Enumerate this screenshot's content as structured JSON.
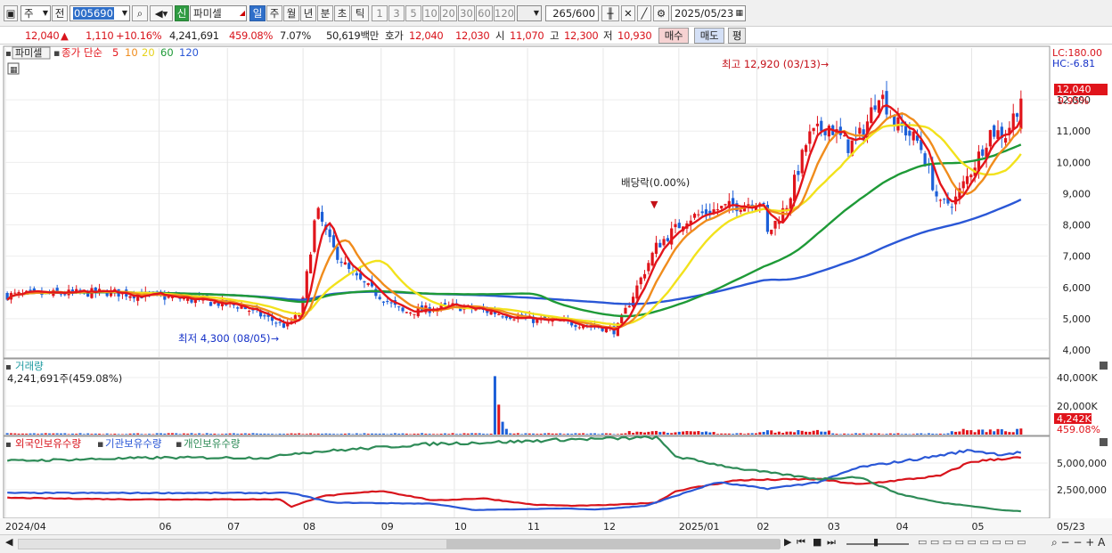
{
  "toolbar": {
    "market": "주",
    "ref_label": "전",
    "code": "005690",
    "badge": "신",
    "name": "파미셀",
    "periods": [
      "일",
      "주",
      "월",
      "년",
      "분",
      "초",
      "틱"
    ],
    "active_period": "일",
    "intervals": [
      "1",
      "3",
      "5",
      "10",
      "20",
      "30",
      "60",
      "120"
    ],
    "count": "265",
    "count_max": "/600",
    "date": "2025/05/23"
  },
  "quote": {
    "price": "12,040",
    "arrow": "▲",
    "change": "1,110",
    "change_pct": "+10.16%",
    "volume": "4,241,691",
    "volume_ratio": "459.08%",
    "turnover": "7.07%",
    "value": "50,619백만",
    "ask_label": "호가",
    "ask": "12,040",
    "bid": "12,030",
    "open_label": "시",
    "open": "11,070",
    "high_label": "고",
    "high": "12,300",
    "low_label": "저",
    "low": "10,930",
    "buy_btn": "매수",
    "sell_btn": "매도",
    "eval_btn": "평"
  },
  "price_panel": {
    "stock_tag": "파미셀",
    "legend_close": "종가 단순",
    "ma_labels": [
      "5",
      "10",
      "20",
      "60",
      "120"
    ],
    "lc": "LC:180.00",
    "hc": "HC:-6.81",
    "last_price": "12,040",
    "last_pct": "9.95%",
    "high_annot": "최고 12,920 (03/13)",
    "low_annot": "최저 4,300 (08/05)",
    "dividend_annot": "배당락(0.00%)"
  },
  "volume_panel": {
    "title": "거래량",
    "value": "4,241,691주(459.08%)",
    "last": "4,242K",
    "last_pct": "459.08%"
  },
  "holdings_panel": {
    "legend": [
      "외국인보유수량",
      "기관보유수량",
      "개인보유수량"
    ]
  },
  "x_axis": {
    "labels": [
      "2024/04",
      "06",
      "07",
      "08",
      "09",
      "10",
      "11",
      "12",
      "2025/01",
      "02",
      "03",
      "04",
      "05",
      "05/23"
    ]
  },
  "colors": {
    "up": "#e0141b",
    "down": "#1c5fd8",
    "ma5": "#e3151b",
    "ma10": "#f08c1c",
    "ma20": "#f2e21c",
    "ma60": "#1e9a37",
    "ma120": "#2a57d6",
    "foreign": "#d8141c",
    "institution": "#2a57d6",
    "individual": "#2e8b57"
  },
  "chart_data": [
    {
      "type": "candlestick",
      "title": "파미셀",
      "ylim": [
        3800,
        13200
      ],
      "yticks": [
        4000,
        5000,
        6000,
        7000,
        8000,
        9000,
        10000,
        11000,
        12000
      ],
      "date_range": [
        "2024-04-01",
        "2025-05-23"
      ],
      "ohlc_monthly": [
        {
          "month": "2024-04",
          "open": 5700,
          "high": 6000,
          "low": 5500,
          "close": 5750
        },
        {
          "month": "2024-05",
          "open": 5750,
          "high": 6100,
          "low": 5500,
          "close": 5650
        },
        {
          "month": "2024-06",
          "open": 5650,
          "high": 6000,
          "low": 5500,
          "close": 5600
        },
        {
          "month": "2024-07",
          "open": 5600,
          "high": 5800,
          "low": 5000,
          "close": 5100
        },
        {
          "month": "2024-08",
          "open": 5100,
          "high": 8800,
          "low": 4300,
          "close": 6000
        },
        {
          "month": "2024-09",
          "open": 6000,
          "high": 6300,
          "low": 5000,
          "close": 5400
        },
        {
          "month": "2024-10",
          "open": 5400,
          "high": 5600,
          "low": 4900,
          "close": 5000
        },
        {
          "month": "2024-11",
          "open": 5000,
          "high": 5200,
          "low": 4500,
          "close": 4850
        },
        {
          "month": "2024-12",
          "open": 4850,
          "high": 8500,
          "low": 4400,
          "close": 8300
        },
        {
          "month": "2025-01",
          "open": 8300,
          "high": 9600,
          "low": 8000,
          "close": 8900
        },
        {
          "month": "2025-02",
          "open": 8900,
          "high": 11800,
          "low": 7300,
          "close": 11200
        },
        {
          "month": "2025-03",
          "open": 11200,
          "high": 12920,
          "low": 9800,
          "close": 10300
        },
        {
          "month": "2025-04",
          "open": 10300,
          "high": 10600,
          "low": 8100,
          "close": 10100
        },
        {
          "month": "2025-05",
          "open": 10100,
          "high": 12300,
          "low": 10000,
          "close": 12040
        }
      ],
      "last": {
        "date": "2025-05-23",
        "open": 11070,
        "high": 12300,
        "low": 10930,
        "close": 12040,
        "volume": 4241691
      },
      "moving_average_periods": [
        5,
        10,
        20,
        60,
        120
      ],
      "ma_end_values": {
        "ma5": 11050,
        "ma10": 11250,
        "ma20": 10900,
        "ma60": 10600,
        "ma120": 9250
      },
      "annotations": [
        {
          "label": "최고 12,920 (03/13)",
          "date": "2025-03-13",
          "value": 12920
        },
        {
          "label": "최저 4,300 (08/05)",
          "date": "2024-08-05",
          "value": 4300
        },
        {
          "label": "배당락(0.00%)",
          "date": "2024-12-27"
        }
      ]
    },
    {
      "type": "bar",
      "title": "거래량",
      "ylim": [
        0,
        50000
      ],
      "yticks_label": [
        "20,000K",
        "40,000K"
      ],
      "yticks": [
        20000,
        40000
      ],
      "unit": "K",
      "notable_spikes": [
        {
          "date": "2024-08-19",
          "value": 41000
        },
        {
          "date": "2024-08-20",
          "value": 21000
        },
        {
          "date": "2024-08-21",
          "value": 9000
        }
      ],
      "last_value": 4242
    },
    {
      "type": "line",
      "series_names": [
        "외국인보유수량",
        "기관보유수량",
        "개인보유수량"
      ],
      "ylim": [
        0,
        7000000
      ],
      "yticks": [
        2500000,
        5000000
      ],
      "yticks_label": [
        "2,500,000",
        "5,000,000"
      ],
      "series": [
        {
          "name": "외국인보유수량",
          "points": [
            [
              0,
              1750000
            ],
            [
              0.12,
              1600000
            ],
            [
              0.23,
              1600000
            ],
            [
              0.27,
              1600000
            ],
            [
              0.28,
              900000
            ],
            [
              0.31,
              1900000
            ],
            [
              0.37,
              2400000
            ],
            [
              0.42,
              1500000
            ],
            [
              0.47,
              1700000
            ],
            [
              0.52,
              1100000
            ],
            [
              0.56,
              1000000
            ],
            [
              0.6,
              1100000
            ],
            [
              0.64,
              1300000
            ],
            [
              0.66,
              2400000
            ],
            [
              0.72,
              3400000
            ],
            [
              0.8,
              3500000
            ],
            [
              0.84,
              3000000
            ],
            [
              0.88,
              3400000
            ],
            [
              0.92,
              3800000
            ],
            [
              0.95,
              5100000
            ],
            [
              0.98,
              5400000
            ],
            [
              1,
              5500000
            ]
          ]
        },
        {
          "name": "기관보유수량",
          "points": [
            [
              0,
              2200000
            ],
            [
              0.2,
              2200000
            ],
            [
              0.28,
              2200000
            ],
            [
              0.32,
              1300000
            ],
            [
              0.42,
              1200000
            ],
            [
              0.46,
              600000
            ],
            [
              0.55,
              750000
            ],
            [
              0.58,
              650000
            ],
            [
              0.63,
              1000000
            ],
            [
              0.7,
              3200000
            ],
            [
              0.75,
              2600000
            ],
            [
              0.8,
              3200000
            ],
            [
              0.84,
              4600000
            ],
            [
              0.9,
              5400000
            ],
            [
              0.95,
              6200000
            ],
            [
              0.98,
              5800000
            ],
            [
              1,
              6000000
            ]
          ]
        },
        {
          "name": "개인보유수량",
          "points": [
            [
              0,
              5200000
            ],
            [
              0.15,
              5500000
            ],
            [
              0.26,
              5500000
            ],
            [
              0.28,
              5900000
            ],
            [
              0.42,
              6800000
            ],
            [
              0.5,
              7000000
            ],
            [
              0.55,
              7200000
            ],
            [
              0.6,
              7300000
            ],
            [
              0.64,
              7400000
            ],
            [
              0.66,
              5600000
            ],
            [
              0.72,
              4500000
            ],
            [
              0.8,
              3500000
            ],
            [
              0.84,
              3700000
            ],
            [
              0.88,
              2100000
            ],
            [
              0.92,
              1300000
            ],
            [
              0.95,
              1000000
            ],
            [
              0.98,
              600000
            ],
            [
              1,
              500000
            ]
          ]
        }
      ]
    }
  ]
}
